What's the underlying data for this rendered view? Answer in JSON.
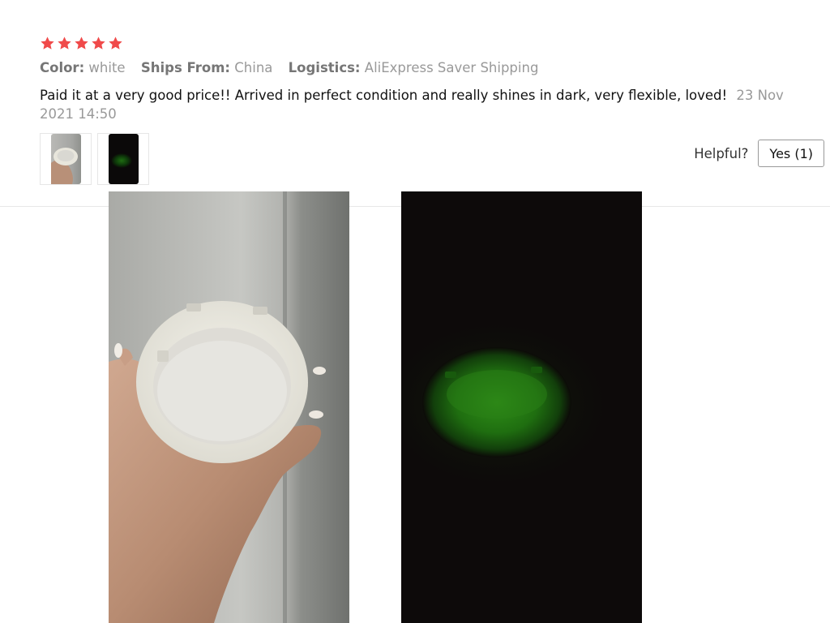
{
  "review": {
    "rating": 5,
    "rating_max": 5,
    "star_color": "#f04a4a",
    "attributes": [
      {
        "label": "Color:",
        "value": "white"
      },
      {
        "label": "Ships From:",
        "value": "China"
      },
      {
        "label": "Logistics:",
        "value": "AliExpress Saver Shipping"
      }
    ],
    "text": "Paid it at a very good price!! Arrived in perfect condition and really shines in dark, very flexible, loved!",
    "date": "23 Nov 2021 14:50",
    "thumbnails": [
      {
        "icon": "ashtray-in-hand-photo-thumbnail"
      },
      {
        "icon": "glowing-ashtray-dark-photo-thumbnail"
      }
    ],
    "helpful_label": "Helpful?",
    "yes_button_label": "Yes (1)"
  },
  "gallery": [
    {
      "icon": "ashtray-held-in-hand-photo"
    },
    {
      "icon": "ashtray-glowing-in-dark-photo"
    }
  ]
}
